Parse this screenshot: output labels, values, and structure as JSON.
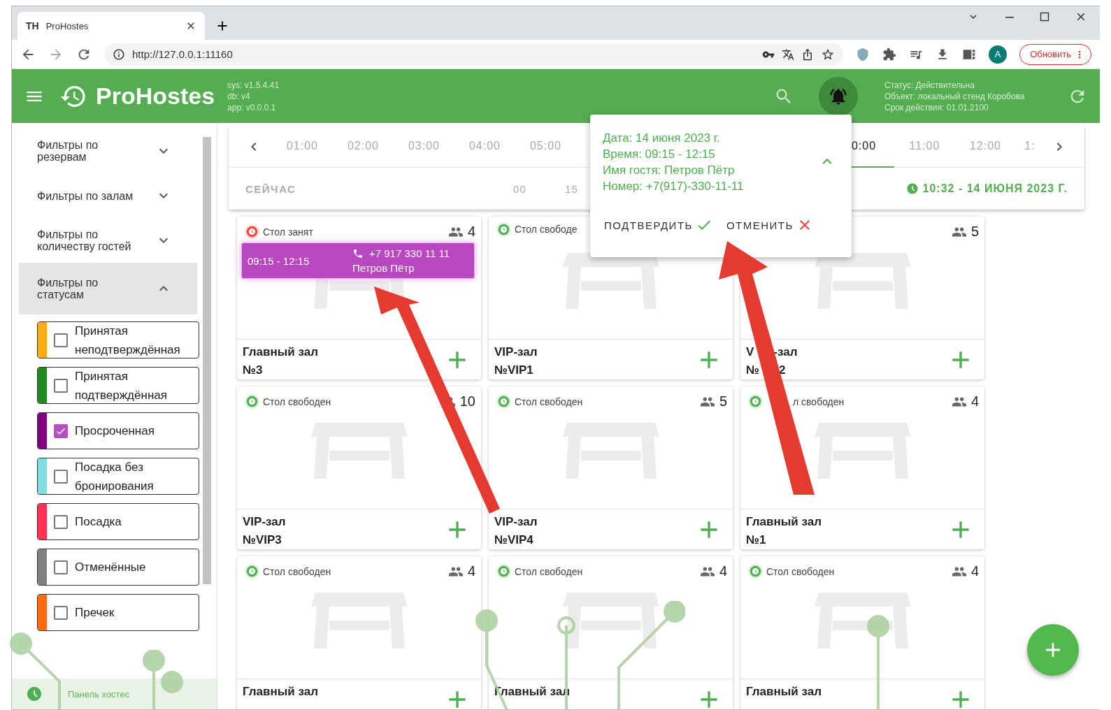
{
  "browser": {
    "favicon": "TH",
    "tab_title": "ProHostes",
    "url": "http://127.0.0.1:11160",
    "update_button": "Обновить",
    "profile_letter": "A"
  },
  "app": {
    "brand": "ProHostes",
    "versions": [
      "sys: v1.5.4.41",
      "db: v4",
      "app: v0.0.0.1"
    ],
    "status_lines": [
      "Статус: Действительна",
      "Объект: локальный стенд Коробова",
      "Срок действия: 01.01.2100"
    ]
  },
  "sidebar": {
    "filters": [
      {
        "label": "Фильтры по резервам",
        "expanded": false
      },
      {
        "label": "Фильтры по залам",
        "expanded": false
      },
      {
        "label": "Фильтры по количеству гостей",
        "expanded": false
      },
      {
        "label": "Фильтры по статусам",
        "expanded": true
      }
    ],
    "statuses": [
      {
        "label": "Принятая неподтверждённая",
        "color": "#ffab19",
        "checked": false
      },
      {
        "label": "Принятая подтверждённая",
        "color": "#1e8a1e",
        "checked": false
      },
      {
        "label": "Просроченная",
        "color": "#800080",
        "checked": true
      },
      {
        "label": "Посадка без бронирования",
        "color": "#7fdde3",
        "checked": false
      },
      {
        "label": "Посадка",
        "color": "#ff3355",
        "checked": false
      },
      {
        "label": "Отменённые",
        "color": "#808080",
        "checked": false
      },
      {
        "label": "Пречек",
        "color": "#ff6a13",
        "checked": false
      }
    ],
    "footer": "Панель хостес"
  },
  "timeline": {
    "hours_left": [
      {
        "label": "01:00",
        "selected": false
      },
      {
        "label": "02:00",
        "selected": false
      },
      {
        "label": "03:00",
        "selected": false
      },
      {
        "label": "04:00",
        "selected": false
      },
      {
        "label": "05:00",
        "selected": false
      }
    ],
    "hours_right": [
      {
        "label": "0:00",
        "selected": true
      },
      {
        "label": "11:00",
        "selected": false
      },
      {
        "label": "12:00",
        "selected": false
      },
      {
        "label": "1:",
        "selected": false
      }
    ],
    "now_label": "СЕЙЧАС",
    "minutes": [
      "00",
      "15"
    ],
    "current": "10:32 - 14 ИЮНЯ 2023 Г."
  },
  "popup": {
    "lines": [
      "Дата: 14 июня 2023 г.",
      "Время: 09:15 - 12:15",
      "Имя гостя: Петров Пётр",
      "Номер: +7(917)-330-11-11"
    ],
    "confirm": "ПОДТВЕРДИТЬ",
    "cancel": "ОТМЕНИТЬ"
  },
  "cards": [
    {
      "kind": "busy",
      "status": "Стол занят",
      "guests": "4",
      "hall": "Главный зал",
      "number": "№3",
      "booking": {
        "time": "09:15 - 12:15",
        "phone": "+7 917 330 11 11",
        "name": "Петров Пётр"
      }
    },
    {
      "kind": "free",
      "status": "Стол свободе",
      "hall": "VIP-зал",
      "number": "№VIP1"
    },
    {
      "kind": "free",
      "guests": "5",
      "hall_parts": [
        "V",
        "-зал"
      ],
      "number_parts": [
        "№",
        "2"
      ]
    },
    {
      "kind": "free",
      "status": "Стол свободен",
      "guests": "10",
      "hall": "VIP-зал",
      "number": "№VIP3"
    },
    {
      "kind": "free",
      "status": "Стол свободен",
      "guests": "5",
      "hall": "VIP-зал",
      "number": "№VIP4"
    },
    {
      "kind": "free",
      "status_tail": "л свободен",
      "guests": "4",
      "hall": "Главный зал",
      "number": "№1"
    },
    {
      "kind": "free",
      "status": "Стол свободен",
      "guests": "4",
      "hall": "Главный зал"
    },
    {
      "kind": "free",
      "status": "Стол свободен",
      "guests": "4",
      "hall": "Главный зал"
    },
    {
      "kind": "free",
      "status": "Стол свободен",
      "guests": "4",
      "hall": "Главный зал"
    }
  ]
}
